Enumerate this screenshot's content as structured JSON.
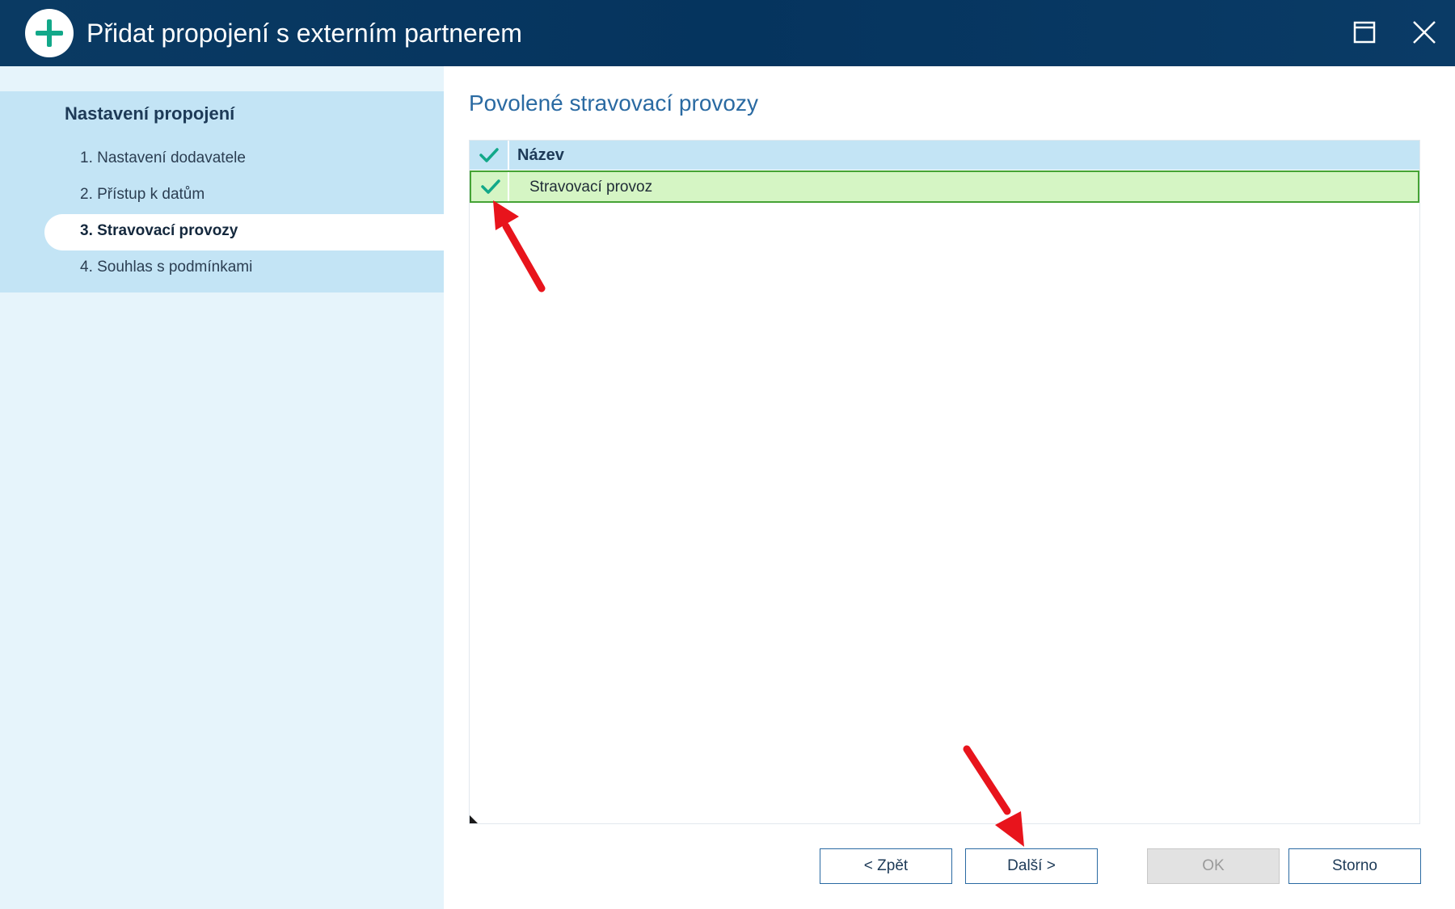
{
  "window": {
    "title": "Přidat propojení s externím partnerem",
    "icon": "plus-icon",
    "controls": [
      "maximize-icon",
      "close-icon"
    ]
  },
  "sidebar": {
    "heading": "Nastavení propojení",
    "steps": [
      {
        "label": "1. Nastavení dodavatele",
        "active": false
      },
      {
        "label": "2. Přístup k datům",
        "active": false
      },
      {
        "label": "3. Stravovací provozy",
        "active": true
      },
      {
        "label": "4. Souhlas s podmínkami",
        "active": false
      }
    ]
  },
  "main": {
    "section_title": "Povolené stravovací provozy",
    "grid": {
      "columns": [
        "",
        "Název"
      ],
      "header_check_icon": "check-icon",
      "rows": [
        {
          "checked": true,
          "name": "Stravovací provoz"
        }
      ]
    }
  },
  "buttons": {
    "back": "< Zpět",
    "next": "Další >",
    "ok": "OK",
    "cancel": "Storno"
  },
  "colors": {
    "titlebar": "#05345e",
    "accent": "#12a889",
    "sidebar_bg": "#e6f4fb",
    "sidebar_block": "#c3e4f5",
    "selected_row": "#d5f5c4",
    "selected_row_border": "#45a335",
    "annotation_arrow": "#e8141c"
  }
}
